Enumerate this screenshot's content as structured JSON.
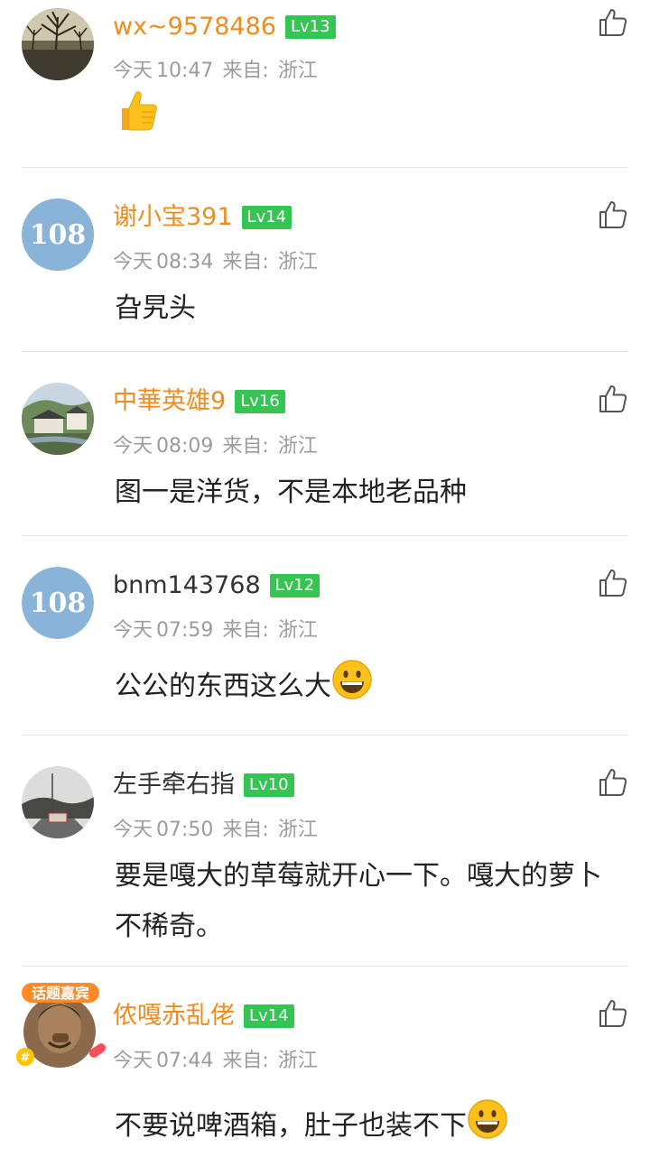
{
  "comments": [
    {
      "username": "wx~9578486",
      "level": "Lv13",
      "date": "今天",
      "time": "10:47",
      "from_label": "来自:",
      "location": "浙江",
      "text": "",
      "emoji": "thumbs-up-emoji"
    },
    {
      "username": "谢小宝391",
      "level": "Lv14",
      "date": "今天",
      "time": "08:34",
      "from_label": "来自:",
      "location": "浙江",
      "text": "旮旯头",
      "avatar_text": "108"
    },
    {
      "username": "中華英雄9",
      "level": "Lv16",
      "date": "今天",
      "time": "08:09",
      "from_label": "来自:",
      "location": "浙江",
      "text": "图一是洋货，不是本地老品种"
    },
    {
      "username": "bnm143768",
      "level": "Lv12",
      "date": "今天",
      "time": "07:59",
      "from_label": "来自:",
      "location": "浙江",
      "text": "公公的东西这么大",
      "avatar_text": "108",
      "emoji": "grinning-face-emoji"
    },
    {
      "username": "左手牵右指",
      "level": "Lv10",
      "date": "今天",
      "time": "07:50",
      "from_label": "来自:",
      "location": "浙江",
      "text": "要是嘎大的草莓就开心一下。嘎大的萝卜不稀奇。"
    },
    {
      "username": "侬嘎赤乱佬",
      "level": "Lv14",
      "date": "今天",
      "time": "07:44",
      "from_label": "来自:",
      "location": "浙江",
      "text": "不要说啤酒箱，肚子也装不下",
      "emoji": "grinning-face-emoji",
      "badge_text": "话题嘉宾"
    }
  ],
  "colors": {
    "username_accent": "#f08c1e",
    "username_default": "#333333",
    "level_badge": "#34c552",
    "meta_text": "#9c9c9c",
    "divider": "#e6e6e6"
  }
}
